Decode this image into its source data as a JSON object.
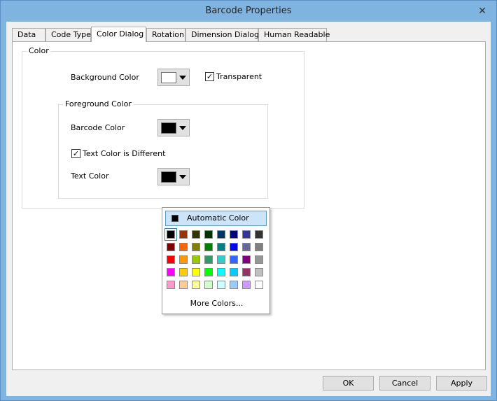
{
  "window": {
    "title": "Barcode Properties",
    "close_glyph": "✕"
  },
  "tabs": [
    {
      "label": "Data"
    },
    {
      "label": "Code Type"
    },
    {
      "label": "Color Dialog"
    },
    {
      "label": "Rotation"
    },
    {
      "label": "Dimension Dialog"
    },
    {
      "label": "Human Readable"
    }
  ],
  "color_group": {
    "title": "Color",
    "background_label": "Background Color",
    "background_color": "#ffffff",
    "transparent_label": "Transparent",
    "transparent_checked": true
  },
  "foreground_group": {
    "title": "Foreground Color",
    "barcode_label": "Barcode Color",
    "barcode_color": "#000000",
    "text_diff_label": "Text Color is Different",
    "text_diff_checked": true,
    "text_color_label": "Text Color",
    "text_color": "#000000"
  },
  "dropdown": {
    "automatic_label": "Automatic Color",
    "more_colors_label": "More Colors...",
    "palette": [
      [
        "#000000",
        "#993300",
        "#333300",
        "#003300",
        "#003366",
        "#000080",
        "#333399",
        "#333333"
      ],
      [
        "#800000",
        "#ff6600",
        "#808000",
        "#008000",
        "#008080",
        "#0000ff",
        "#666699",
        "#808080"
      ],
      [
        "#ff0000",
        "#ff9900",
        "#99cc00",
        "#339966",
        "#33cccc",
        "#3366ff",
        "#800080",
        "#969696"
      ],
      [
        "#ff00ff",
        "#ffcc00",
        "#ffff00",
        "#00ff00",
        "#00ffff",
        "#00ccff",
        "#993366",
        "#c0c0c0"
      ],
      [
        "#ff99cc",
        "#ffcc99",
        "#ffff99",
        "#ccffcc",
        "#ccffff",
        "#99ccff",
        "#cc99ff",
        "#ffffff"
      ]
    ]
  },
  "buttons": {
    "ok": "OK",
    "cancel": "Cancel",
    "apply": "Apply"
  }
}
